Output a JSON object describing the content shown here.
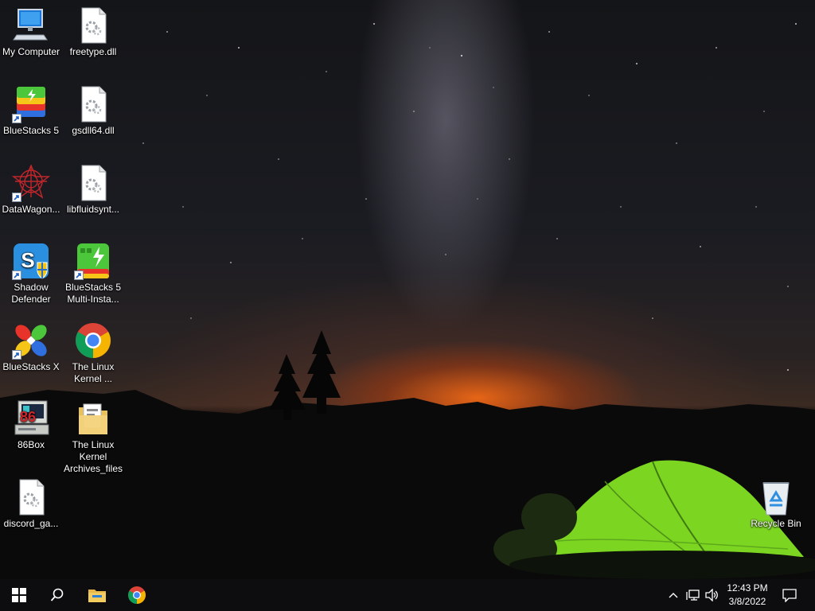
{
  "desktop": {
    "icons": [
      {
        "label": "My Computer",
        "icon": "computer-icon"
      },
      {
        "label": "freetype.dll",
        "icon": "dll-file-icon"
      },
      {
        "label": "BlueStacks 5",
        "icon": "bluestacks-icon"
      },
      {
        "label": "gsdll64.dll",
        "icon": "dll-file-icon"
      },
      {
        "label": "DataWagon...",
        "icon": "datawagon-icon"
      },
      {
        "label": "libfluidsynt...",
        "icon": "dll-file-icon"
      },
      {
        "label": "Shadow Defender",
        "icon": "shadow-defender-icon"
      },
      {
        "label": "BlueStacks 5 Multi-Insta...",
        "icon": "bluestacks-multi-instance-icon"
      },
      {
        "label": "BlueStacks X",
        "icon": "bluestacks-x-icon"
      },
      {
        "label": "The Linux Kernel ...",
        "icon": "chrome-icon"
      },
      {
        "label": "86Box",
        "icon": "86box-icon"
      },
      {
        "label": "The Linux Kernel Archives_files",
        "icon": "folder-icon"
      },
      {
        "label": "discord_ga...",
        "icon": "dll-file-icon"
      },
      {
        "label": "Recycle Bin",
        "icon": "recycle-bin-icon"
      }
    ]
  },
  "taskbar": {
    "start": "windows-start-icon",
    "search": "search-icon",
    "pinned": [
      "file-explorer-icon",
      "chrome-icon"
    ],
    "tray": [
      "chevron-up-icon",
      "network-icon",
      "volume-icon"
    ],
    "time": "12:43 PM",
    "date": "3/8/2022",
    "notifications": "action-center-icon"
  },
  "colors": {
    "taskbar": "#0d0d0f",
    "tent": "#7cd621",
    "horizon_glow": "#ff6e14"
  }
}
